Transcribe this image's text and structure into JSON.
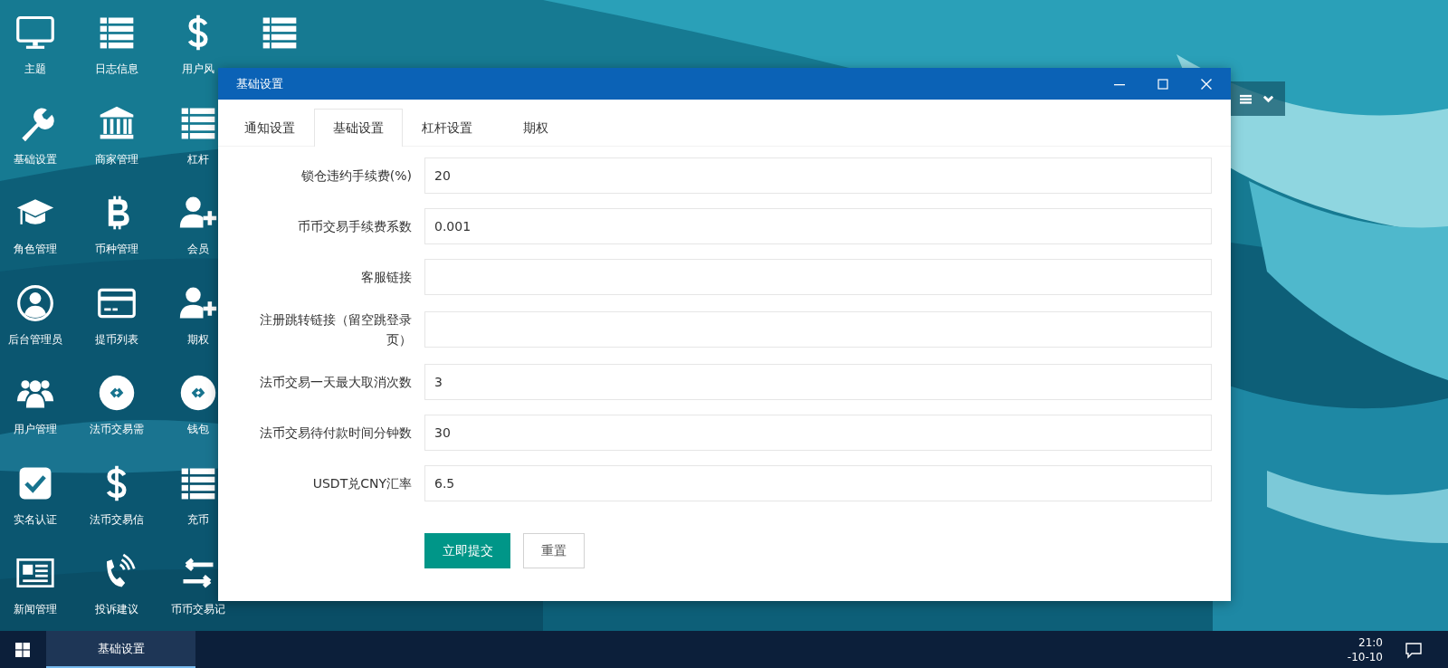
{
  "desktop_icons": [
    {
      "label": "主题"
    },
    {
      "label": "基础设置"
    },
    {
      "label": "角色管理"
    },
    {
      "label": "后台管理员"
    },
    {
      "label": "用户管理"
    },
    {
      "label": "实名认证"
    },
    {
      "label": "新闻管理"
    },
    {
      "label": "日志信息"
    },
    {
      "label": "商家管理"
    },
    {
      "label": "币种管理"
    },
    {
      "label": "提币列表"
    },
    {
      "label": "法币交易需"
    },
    {
      "label": "法币交易信"
    },
    {
      "label": "投诉建议"
    },
    {
      "label": "用户风"
    },
    {
      "label": "杠杆"
    },
    {
      "label": "会员"
    },
    {
      "label": "期权"
    },
    {
      "label": "钱包"
    },
    {
      "label": "充币"
    },
    {
      "label": "币币交易记"
    }
  ],
  "window": {
    "title": "基础设置",
    "tabs": [
      {
        "label": "通知设置",
        "selected": false
      },
      {
        "label": "基础设置",
        "selected": true
      },
      {
        "label": "杠杆设置",
        "selected": false
      },
      {
        "label": "期权",
        "selected": false
      }
    ],
    "fields": [
      {
        "label": "锁仓违约手续费(%)",
        "value": "20"
      },
      {
        "label": "币币交易手续费系数",
        "value": "0.001"
      },
      {
        "label": "客服链接"
      },
      {
        "label": "注册跳转链接（留空跳登录页）"
      },
      {
        "label": "法币交易一天最大取消次数",
        "value": "3"
      },
      {
        "label": "法币交易待付款时间分钟数",
        "value": "30"
      },
      {
        "label": "USDT兑CNY汇率",
        "value": "6.5"
      }
    ],
    "buttons": [
      {
        "label": "立即提交",
        "kind": "primary"
      },
      {
        "label": "重置",
        "kind": "default"
      }
    ]
  },
  "taskbar": {
    "tasks": [
      {
        "label": "基础设置",
        "selected": true
      }
    ],
    "time": "21:0",
    "date": "-10-10"
  }
}
